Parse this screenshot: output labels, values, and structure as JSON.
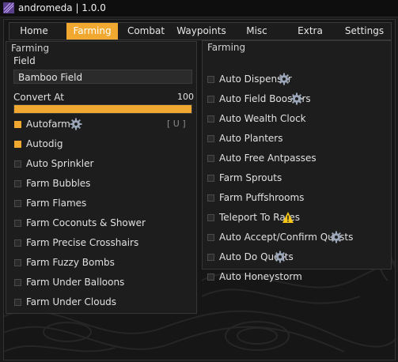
{
  "window": {
    "title": "andromeda | 1.0.0"
  },
  "tabs": [
    "Home",
    "Farming",
    "Combat",
    "Waypoints",
    "Misc",
    "Extra",
    "Settings"
  ],
  "active_tab": "Farming",
  "left_panel": {
    "title": "Farming",
    "field_label": "Field",
    "field_value": "Bamboo Field",
    "slider_label": "Convert At",
    "slider_value": "100",
    "slider_fraction": 1.0,
    "autofarm_keybind": "[ U ]",
    "items": [
      {
        "label": "Autofarm",
        "checked": true
      },
      {
        "label": "Autodig",
        "checked": true
      },
      {
        "label": "Auto Sprinkler",
        "checked": false
      },
      {
        "label": "Farm Bubbles",
        "checked": false
      },
      {
        "label": "Farm Flames",
        "checked": false
      },
      {
        "label": "Farm Coconuts & Shower",
        "checked": false
      },
      {
        "label": "Farm Precise Crosshairs",
        "checked": false
      },
      {
        "label": "Farm Fuzzy Bombs",
        "checked": false
      },
      {
        "label": "Farm Under Balloons",
        "checked": false
      },
      {
        "label": "Farm Under Clouds",
        "checked": false
      }
    ]
  },
  "right_panel": {
    "title": "Farming",
    "items": [
      {
        "label": "Auto Dispenser",
        "checked": false,
        "icon": "gear-icon"
      },
      {
        "label": "Auto Field Boosters",
        "checked": false,
        "icon": "gear-icon"
      },
      {
        "label": "Auto Wealth Clock",
        "checked": false,
        "icon": ""
      },
      {
        "label": "Auto Planters",
        "checked": false,
        "icon": ""
      },
      {
        "label": "Auto Free Antpasses",
        "checked": false,
        "icon": ""
      },
      {
        "label": "Farm Sprouts",
        "checked": false,
        "icon": ""
      },
      {
        "label": "Farm Puffshrooms",
        "checked": false,
        "icon": ""
      },
      {
        "label": "Teleport To Rares",
        "checked": false,
        "icon": "warning-icon"
      },
      {
        "label": "Auto Accept/Confirm Quests",
        "checked": false,
        "icon": "gear-icon"
      },
      {
        "label": "Auto Do Quests",
        "checked": false,
        "icon": "gear-icon"
      },
      {
        "label": "Auto Honeystorm",
        "checked": false,
        "icon": ""
      }
    ]
  },
  "colors": {
    "accent": "#f0a830",
    "background": "#161616",
    "panel": "#1d1d1d"
  }
}
